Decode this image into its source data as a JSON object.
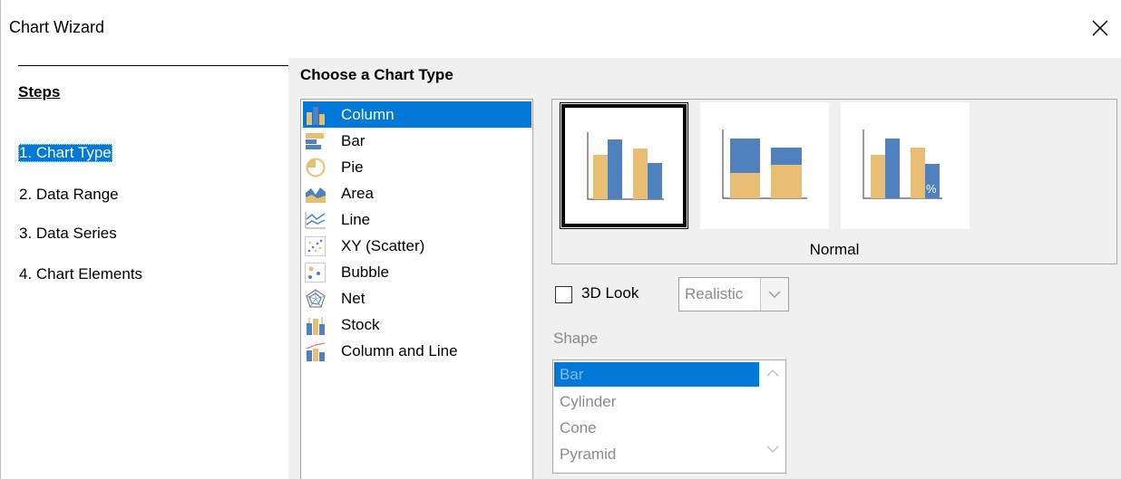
{
  "window": {
    "title": "Chart Wizard"
  },
  "steps": {
    "title": "Steps",
    "items": [
      {
        "label": "1. Chart Type",
        "selected": true
      },
      {
        "label": "2. Data Range"
      },
      {
        "label": "3. Data Series"
      },
      {
        "label": "4. Chart Elements"
      }
    ]
  },
  "chart_type": {
    "section_title": "Choose a Chart Type",
    "types": [
      {
        "label": "Column",
        "icon": "column-chart-icon",
        "selected": true
      },
      {
        "label": "Bar",
        "icon": "bar-chart-icon"
      },
      {
        "label": "Pie",
        "icon": "pie-chart-icon"
      },
      {
        "label": "Area",
        "icon": "area-chart-icon"
      },
      {
        "label": "Line",
        "icon": "line-chart-icon"
      },
      {
        "label": "XY (Scatter)",
        "icon": "scatter-chart-icon"
      },
      {
        "label": "Bubble",
        "icon": "bubble-chart-icon"
      },
      {
        "label": "Net",
        "icon": "net-chart-icon"
      },
      {
        "label": "Stock",
        "icon": "stock-chart-icon"
      },
      {
        "label": "Column and Line",
        "icon": "column-line-chart-icon"
      }
    ],
    "subtype_label": "Normal",
    "look_3d": {
      "label": "3D Look",
      "checked": false,
      "mode": "Realistic"
    },
    "shape": {
      "label": "Shape",
      "options": [
        "Bar",
        "Cylinder",
        "Cone",
        "Pyramid"
      ],
      "selected": "Bar"
    }
  },
  "colors": {
    "accent": "#0078d7",
    "bar_blue": "#4f81bd",
    "bar_tan": "#e8bd74"
  }
}
